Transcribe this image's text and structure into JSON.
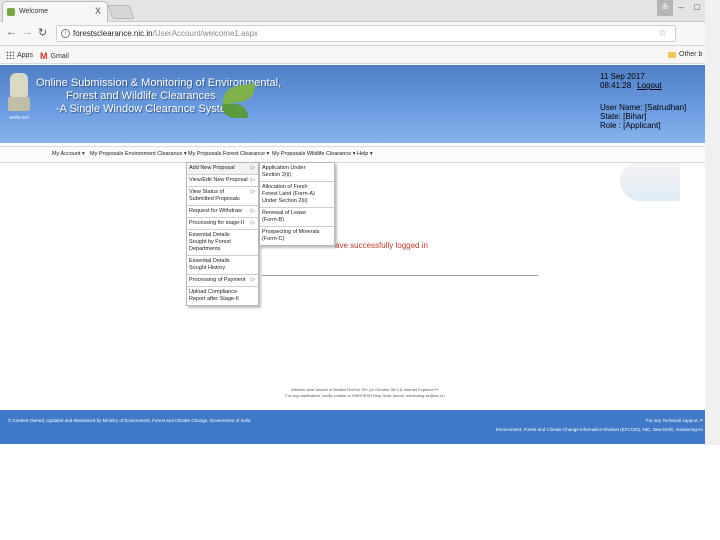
{
  "browser": {
    "tab_title": "Welcome",
    "tab_close": "X",
    "window_user": "≗",
    "window_minimize": "–",
    "window_maximize": "□",
    "url_host": "forestsclearance.nic.in",
    "url_path": "/UserAccount/welcome1.aspx",
    "bookmarks": [
      {
        "label": "Apps"
      },
      {
        "label": "Gmail"
      }
    ],
    "other_bookmarks": "Other b"
  },
  "header": {
    "title_line1": "Online Submission & Monitoring of Environmental,",
    "title_line2": "Forest and Wildlife Clearances",
    "title_line3": "-A Single Window Clearance System",
    "emblem_caption": "सत्यमेव जयते",
    "datetime": "11 Sep 2017 08:41:28",
    "logout": "Logout",
    "user_name": "User Name: [Satrudhan]",
    "state": "State: [Bihar]",
    "role": "Role : [Applicant]"
  },
  "menu": [
    {
      "label": "My Account ▾"
    },
    {
      "label": "My Proposals Environment Clearance ▾"
    },
    {
      "label": "My Proposals Forest Clearance ▾"
    },
    {
      "label": "My Proposals Wildlife Clearance ▾"
    },
    {
      "label": "Help ▾"
    }
  ],
  "dropdown_main": [
    {
      "label": "Add New Proposal",
      "arrow": "▷"
    },
    {
      "label": "View/Edit New Proposal",
      "arrow": "▷"
    },
    {
      "label": "View Status of Submitted Proposals",
      "arrow": "▷"
    },
    {
      "label": "Request for Withdraw",
      "arrow": "▷"
    },
    {
      "label": "Processing for stage-II",
      "arrow": "▷"
    },
    {
      "label": "Essential Details Sought by Forest Departments",
      "arrow": ""
    },
    {
      "label": "Essential Details Sought History",
      "arrow": ""
    },
    {
      "label": "Processing of Payment",
      "arrow": "▷"
    },
    {
      "label": "Upload Compliance Report after Stage-II",
      "arrow": ""
    }
  ],
  "dropdown_sub": [
    {
      "label": "Application Under Section 2(ii)"
    },
    {
      "label": "Allocation of Fresh Forest Land (Form-A) Under Section 2(ii)"
    },
    {
      "label": "Renewal of Lease (Form-B)"
    },
    {
      "label": "Prospecting of Minerals (Form-C)"
    }
  ],
  "welcome_message": "ave successfully logged in",
  "footnote_line1": "Website best viewed in Mozilla FireFox 20+ (or Chrome 38+) & Internet Explorer 9+",
  "footnote_line2": "For any clarification, kindly contact to PARIVESH Help Desk (email: monitoring-ec@nic.in)",
  "footer": {
    "left": "© Content Owned, Updated and Maintained by Ministry of Environment, Forest and Climate Change, Government of India",
    "right1": "For any Technical support, P",
    "right2": "Environment, Forest and Climate Change Informatics Division (EFCCID), NIC, New Delhi, monitoring-ec"
  }
}
